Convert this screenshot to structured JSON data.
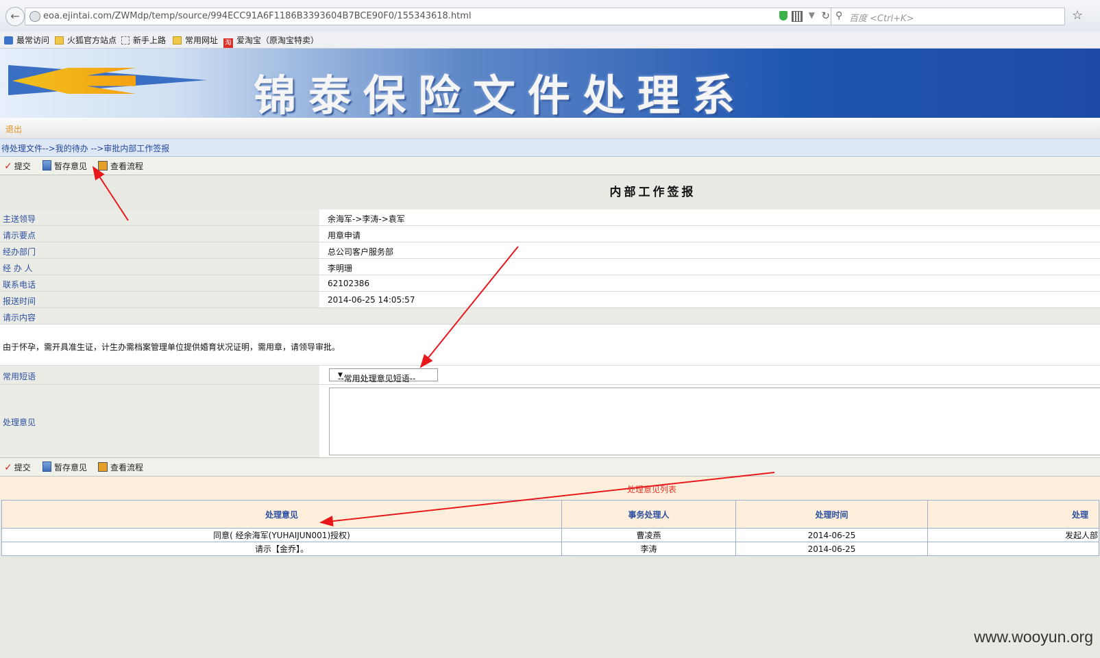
{
  "browser": {
    "url": "eoa.ejintai.com/ZWMdp/temp/source/994ECC91A6F1186B3393604B7BCE90F0/155343618.html",
    "search_placeholder": "百度 <Ctrl+K>",
    "bookmarks": [
      "最常访问",
      "火狐官方站点",
      "新手上路",
      "常用网址",
      "爱淘宝（原淘宝特卖）"
    ],
    "taobao_glyph": "淘"
  },
  "banner": {
    "title": "锦泰保险文件处理系"
  },
  "nav": {
    "logout": "退出",
    "breadcrumb": "待处理文件-->我的待办 -->审批内部工作签报"
  },
  "toolbar": {
    "submit": "提交",
    "save_draft": "暂存意见",
    "view_flow": "查看流程"
  },
  "document": {
    "title": "内部工作签报",
    "fields": [
      {
        "label": "主送领导",
        "value": "余海军->李涛->袁军"
      },
      {
        "label": "请示要点",
        "value": "用章申请"
      },
      {
        "label": "经办部门",
        "value": "总公司客户服务部"
      },
      {
        "label": "经 办 人",
        "value": "李明珊"
      },
      {
        "label": "联系电话",
        "value": "62102386"
      },
      {
        "label": "报送时间",
        "value": "2014-06-25 14:05:57"
      }
    ],
    "content_label": "请示内容",
    "content_text": "由于怀孕，需开具准生证，计生办需档案管理单位提供婚育状况证明，需用章，请领导审批。",
    "phrase_label": "常用短语",
    "phrase_select": "--常用处理意见短语--",
    "opinion_label": "处理意见"
  },
  "opinion_list": {
    "title": "处理意见列表",
    "headers": [
      "处理意见",
      "事务处理人",
      "处理时间",
      "处理"
    ],
    "rows": [
      [
        "同意( 经余海军(YUHAIJUN001)授权)",
        "曹凌燕",
        "2014-06-25",
        "发起人部"
      ],
      [
        "请示【金乔】。",
        "李涛",
        "2014-06-25",
        ""
      ]
    ]
  },
  "watermark": "www.wooyun.org",
  "colors": {
    "label_text": "#2b4ea0",
    "annotation_arrow": "#e8171c",
    "logout": "#e8901a"
  }
}
